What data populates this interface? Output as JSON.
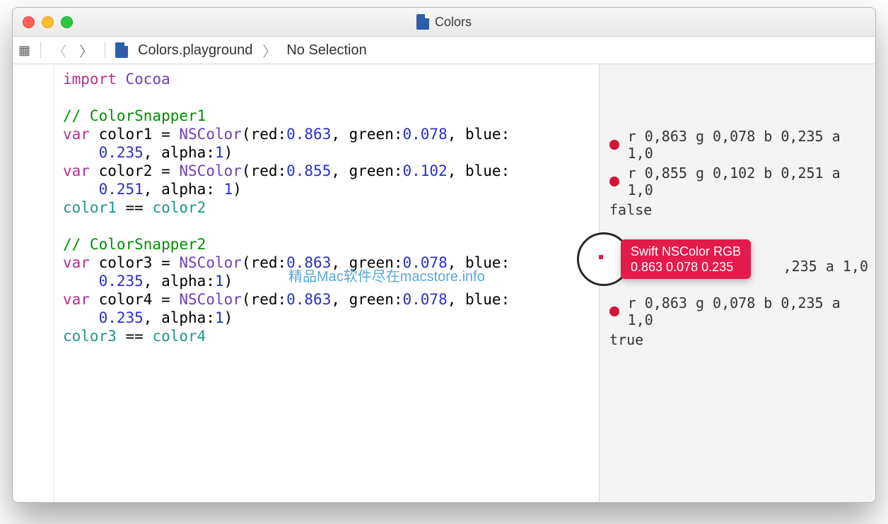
{
  "window": {
    "title": "Colors"
  },
  "jumpbar": {
    "file": "Colors.playground",
    "selection": "No Selection"
  },
  "code": {
    "l1_import": "import",
    "l1_module": "Cocoa",
    "c1": "// ColorSnapper1",
    "v1_kw": "var",
    "v1_name": "color1",
    "v1_eq": " = ",
    "v1_cls": "NSColor",
    "v1_open": "(red:",
    "v1_r": "0.863",
    "v1_g_lbl": ", green:",
    "v1_g": "0.078",
    "v1_b_lbl": ", blue:",
    "v1_indent": "    ",
    "v1_b": "0.235",
    "v1_a_lbl": ", alpha:",
    "v1_a": "1",
    "v1_close": ")",
    "v2_kw": "var",
    "v2_name": "color2",
    "v2_cls": "NSColor",
    "v2_open": "(red:",
    "v2_r": "0.855",
    "v2_g_lbl": ", green:",
    "v2_g": "0.102",
    "v2_b_lbl": ", blue:",
    "v2_b": "0.251",
    "v2_a_lbl": ", alpha: ",
    "v2_a": "1",
    "v2_close": ")",
    "cmp1_l": "color1",
    "cmp1_op": " == ",
    "cmp1_r": "color2",
    "c2": "// ColorSnapper2",
    "v3_kw": "var",
    "v3_name": "color3",
    "v3_cls": "NSColor",
    "v3_open": "(red:",
    "v3_r": "0.863",
    "v3_g_lbl": ", green:",
    "v3_g": "0.078",
    "v3_b_lbl": ", blue:",
    "v3_b": "0.235",
    "v3_a_lbl": ", alpha:",
    "v3_a": "1",
    "v3_close": ")",
    "v4_kw": "var",
    "v4_name": "color4",
    "v4_cls": "NSColor",
    "v4_open": "(red:",
    "v4_r": "0.863",
    "v4_g_lbl": ", green:",
    "v4_g": "0.078",
    "v4_b_lbl": ", blue:",
    "v4_b": "0.235",
    "v4_a_lbl": ", alpha:",
    "v4_a": "1",
    "v4_close": ")",
    "cmp2_l": "color3",
    "cmp2_op": " == ",
    "cmp2_r": "color4"
  },
  "results": {
    "r1": "r 0,863 g 0,078 b 0,235 a 1,0",
    "r2": "r 0,855 g 0,102 b 0,251 a 1,0",
    "r3": "false",
    "r4": ",235 a 1,0",
    "r5": "r 0,863 g 0,078 b 0,235 a 1,0",
    "r6": "true"
  },
  "tooltip": {
    "title": "Swift NSColor RGB",
    "values": "0.863 0.078 0.235"
  },
  "watermark": "精品Mac软件尽在macstore.info"
}
